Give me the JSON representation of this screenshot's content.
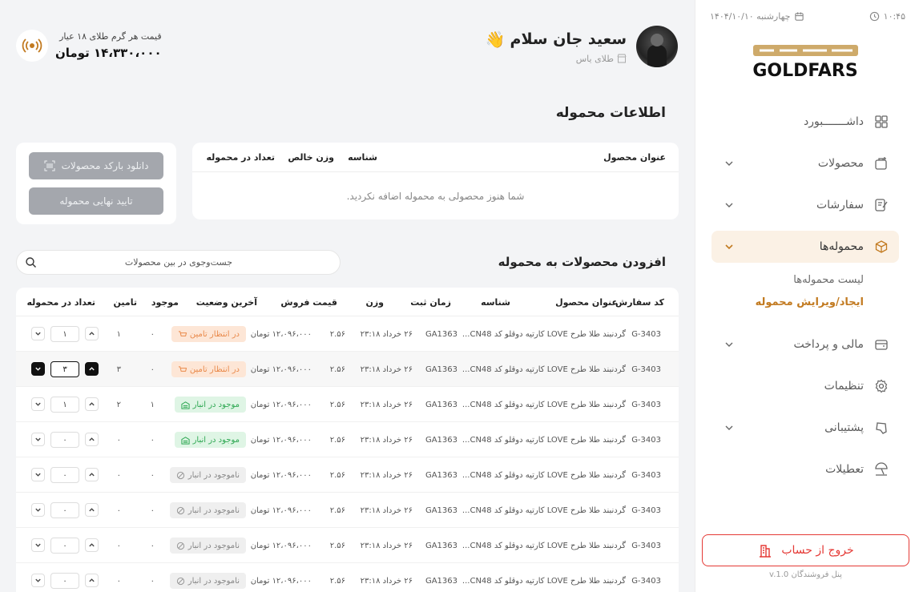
{
  "sidebar": {
    "date": "چهارشنبه ۱۴۰۴/۱۰/۱۰",
    "time": "۱۰:۴۵",
    "logo_text": "GOLDFARS",
    "nav": [
      {
        "label": "داشـــــــبورد",
        "icon": "dashboard-icon",
        "chevron": false,
        "active": false
      },
      {
        "label": "محصولات",
        "icon": "products-icon",
        "chevron": true,
        "active": false
      },
      {
        "label": "سفارشات",
        "icon": "orders-icon",
        "chevron": true,
        "active": false
      },
      {
        "label": "محموله‌ها",
        "icon": "shipments-box-icon",
        "chevron": true,
        "active": true
      },
      {
        "label": "مالی و پرداخت",
        "icon": "wallet-icon",
        "chevron": true,
        "active": false
      },
      {
        "label": "تنظیمات",
        "icon": "gear-icon",
        "chevron": false,
        "active": false
      },
      {
        "label": "پشتیبانی",
        "icon": "support-icon",
        "chevron": true,
        "active": false
      },
      {
        "label": "تعطیلات",
        "icon": "beach-umbrella-icon",
        "chevron": false,
        "active": false
      }
    ],
    "sub_items": [
      "لیست محموله‌ها",
      "ایجاد/ویرایش محموله"
    ],
    "logout_label": "خروج از حساب",
    "version": "پنل فروشندگان v.1.0"
  },
  "header": {
    "greeting": "سعید جان سلام",
    "wave": "👋",
    "role": "طلای یاس",
    "gold_label": "قیمت هر گرم طلای ۱۸ عیار",
    "gold_price": "۱۴،۳۳۰،۰۰۰ تومان"
  },
  "shipment_info": {
    "title": "اطلاعات محموله",
    "columns": [
      "عنوان محصول",
      "شناسه",
      "وزن خالص",
      "تعداد در محموله"
    ],
    "empty_text": "شما هنوز محصولی به محموله اضافه نکردید.",
    "download_barcode": "دانلود بارکد محصولات",
    "confirm": "تایید نهایی محموله"
  },
  "add_products": {
    "title": "افزودن محصولات به محموله",
    "search_placeholder": "جست‌وجوی در بین محصولات",
    "columns": [
      "کد سفارش",
      "عنوان محصول",
      "شناسه",
      "زمان ثبت",
      "وزن",
      "قیمت فروش",
      "آخرین وضعیت",
      "موجود",
      "تامین",
      "تعداد در محموله"
    ],
    "rows": [
      {
        "code": "G-3403",
        "title": "گردنبند طلا طرح LOVE کارتیه دوقلو کد CN48...",
        "sku": "GA1363",
        "date": "۲۶ خرداد ۲۳:۱۸",
        "weight": "۲.۵۶",
        "price": "۱۲،۰۹۶،۰۰۰ تومان",
        "status": "در انتظار تامین",
        "status_type": "wait",
        "stock": "۰",
        "supply": "۱",
        "qty": "۱",
        "selected": false
      },
      {
        "code": "G-3403",
        "title": "گردنبند طلا طرح LOVE کارتیه دوقلو کد CN48...",
        "sku": "GA1363",
        "date": "۲۶ خرداد ۲۳:۱۸",
        "weight": "۲.۵۶",
        "price": "۱۲،۰۹۶،۰۰۰ تومان",
        "status": "در انتظار تامین",
        "status_type": "wait",
        "stock": "۰",
        "supply": "۳",
        "qty": "۳",
        "selected": true
      },
      {
        "code": "G-3403",
        "title": "گردنبند طلا طرح LOVE کارتیه دوقلو کد CN48...",
        "sku": "GA1363",
        "date": "۲۶ خرداد ۲۳:۱۸",
        "weight": "۲.۵۶",
        "price": "۱۲،۰۹۶،۰۰۰ تومان",
        "status": "موجود در انبار",
        "status_type": "ok",
        "stock": "۱",
        "supply": "۲",
        "qty": "۱",
        "selected": false
      },
      {
        "code": "G-3403",
        "title": "گردنبند طلا طرح LOVE کارتیه دوقلو کد CN48...",
        "sku": "GA1363",
        "date": "۲۶ خرداد ۲۳:۱۸",
        "weight": "۲.۵۶",
        "price": "۱۲،۰۹۶،۰۰۰ تومان",
        "status": "موجود در انبار",
        "status_type": "ok",
        "stock": "۰",
        "supply": "۰",
        "qty": "۰",
        "selected": false
      },
      {
        "code": "G-3403",
        "title": "گردنبند طلا طرح LOVE کارتیه دوقلو کد CN48...",
        "sku": "GA1363",
        "date": "۲۶ خرداد ۲۳:۱۸",
        "weight": "۲.۵۶",
        "price": "۱۲،۰۹۶،۰۰۰ تومان",
        "status": "ناموجود در انبار",
        "status_type": "no",
        "stock": "۰",
        "supply": "۰",
        "qty": "۰",
        "selected": false
      },
      {
        "code": "G-3403",
        "title": "گردنبند طلا طرح LOVE کارتیه دوقلو کد CN48...",
        "sku": "GA1363",
        "date": "۲۶ خرداد ۲۳:۱۸",
        "weight": "۲.۵۶",
        "price": "۱۲،۰۹۶،۰۰۰ تومان",
        "status": "ناموجود در انبار",
        "status_type": "no",
        "stock": "۰",
        "supply": "۰",
        "qty": "۰",
        "selected": false
      },
      {
        "code": "G-3403",
        "title": "گردنبند طلا طرح LOVE کارتیه دوقلو کد CN48...",
        "sku": "GA1363",
        "date": "۲۶ خرداد ۲۳:۱۸",
        "weight": "۲.۵۶",
        "price": "۱۲،۰۹۶،۰۰۰ تومان",
        "status": "ناموجود در انبار",
        "status_type": "no",
        "stock": "۰",
        "supply": "۰",
        "qty": "۰",
        "selected": false
      },
      {
        "code": "G-3403",
        "title": "گردنبند طلا طرح LOVE کارتیه دوقلو کد CN48...",
        "sku": "GA1363",
        "date": "۲۶ خرداد ۲۳:۱۸",
        "weight": "۲.۵۶",
        "price": "۱۲،۰۹۶،۰۰۰ تومان",
        "status": "ناموجود در انبار",
        "status_type": "no",
        "stock": "۰",
        "supply": "۰",
        "qty": "۰",
        "selected": false
      }
    ]
  },
  "colors": {
    "accent": "#c27a20",
    "danger": "#e53935",
    "wait": "#e98a4b",
    "ok": "#2fa853"
  }
}
